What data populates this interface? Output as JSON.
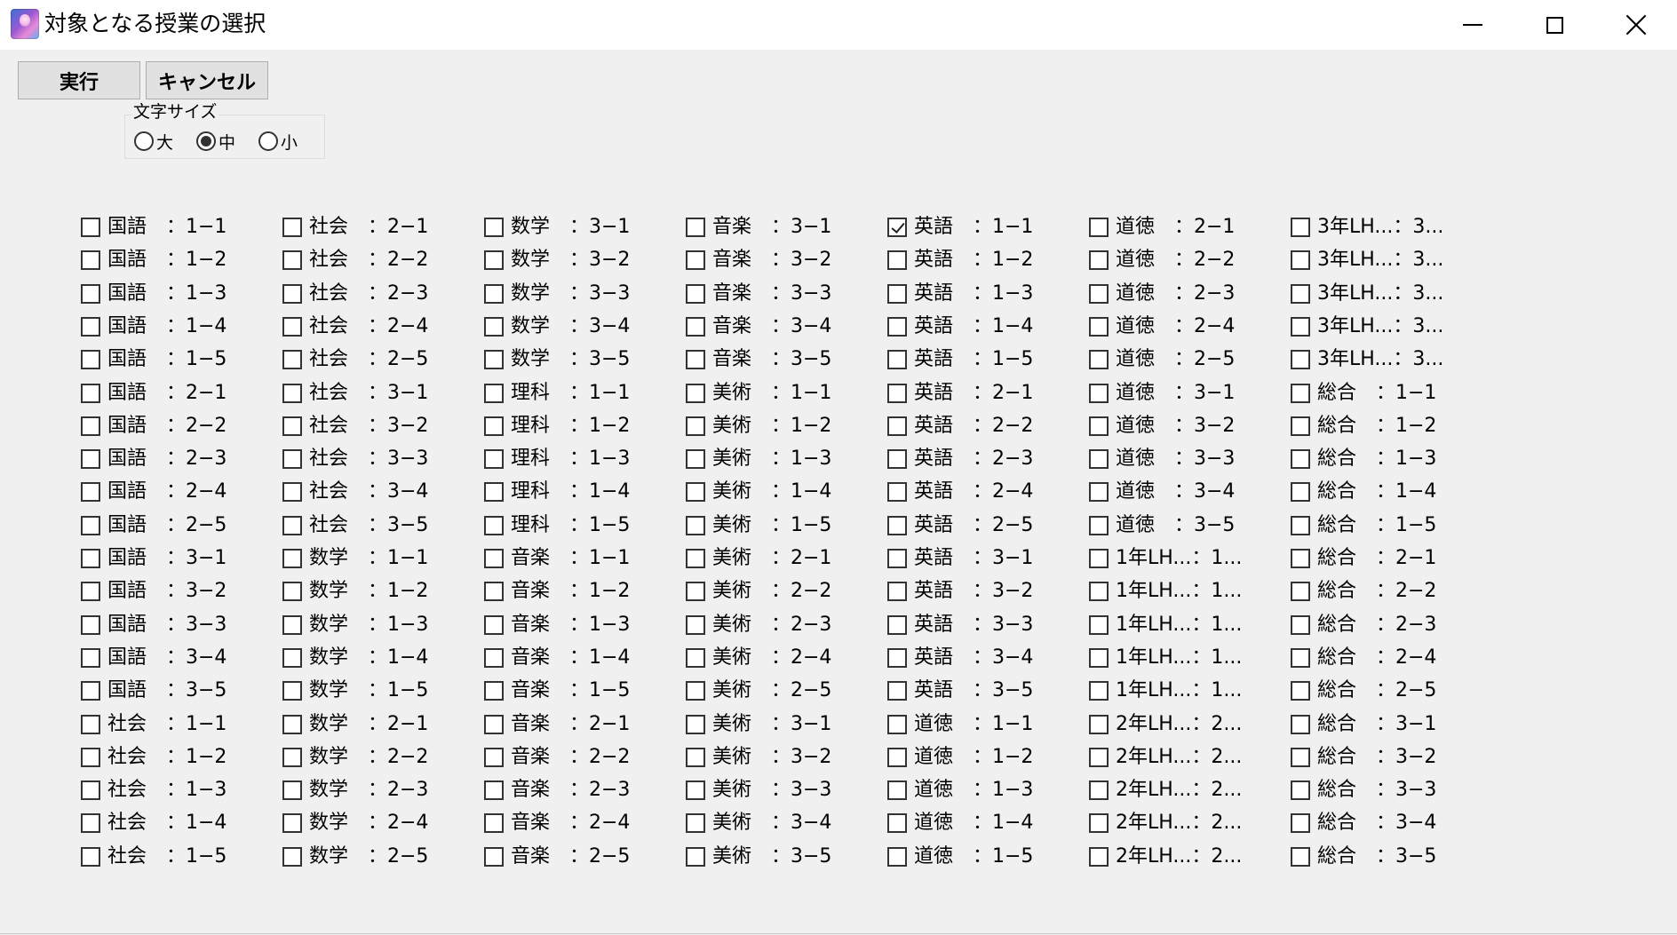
{
  "window": {
    "title": "対象となる授業の選択"
  },
  "toolbar": {
    "run_label": "実行",
    "cancel_label": "キャンセル"
  },
  "font_size": {
    "legend": "文字サイズ",
    "options": [
      {
        "label": "大",
        "selected": false
      },
      {
        "label": "中",
        "selected": true
      },
      {
        "label": "小",
        "selected": false
      }
    ]
  },
  "classes": {
    "columns": [
      [
        "国語　：1−1",
        "国語　：1−2",
        "国語　：1−3",
        "国語　：1−4",
        "国語　：1−5",
        "国語　：2−1",
        "国語　：2−2",
        "国語　：2−3",
        "国語　：2−4",
        "国語　：2−5",
        "国語　：3−1",
        "国語　：3−2",
        "国語　：3−3",
        "国語　：3−4",
        "国語　：3−5",
        "社会　：1−1",
        "社会　：1−2",
        "社会　：1−3",
        "社会　：1−4",
        "社会　：1−5"
      ],
      [
        "社会　：2−1",
        "社会　：2−2",
        "社会　：2−3",
        "社会　：2−4",
        "社会　：2−5",
        "社会　：3−1",
        "社会　：3−2",
        "社会　：3−3",
        "社会　：3−4",
        "社会　：3−5",
        "数学　：1−1",
        "数学　：1−2",
        "数学　：1−3",
        "数学　：1−4",
        "数学　：1−5",
        "数学　：2−1",
        "数学　：2−2",
        "数学　：2−3",
        "数学　：2−4",
        "数学　：2−5"
      ],
      [
        "数学　：3−1",
        "数学　：3−2",
        "数学　：3−3",
        "数学　：3−4",
        "数学　：3−5",
        "理科　：1−1",
        "理科　：1−2",
        "理科　：1−3",
        "理科　：1−4",
        "理科　：1−5",
        "音楽　：1−1",
        "音楽　：1−2",
        "音楽　：1−3",
        "音楽　：1−4",
        "音楽　：1−5",
        "音楽　：2−1",
        "音楽　：2−2",
        "音楽　：2−3",
        "音楽　：2−4",
        "音楽　：2−5"
      ],
      [
        "音楽　：3−1",
        "音楽　：3−2",
        "音楽　：3−3",
        "音楽　：3−4",
        "音楽　：3−5",
        "美術　：1−1",
        "美術　：1−2",
        "美術　：1−3",
        "美術　：1−4",
        "美術　：1−5",
        "美術　：2−1",
        "美術　：2−2",
        "美術　：2−3",
        "美術　：2−4",
        "美術　：2−5",
        "美術　：3−1",
        "美術　：3−2",
        "美術　：3−3",
        "美術　：3−4",
        "美術　：3−5"
      ],
      [
        "英語　：1−1",
        "英語　：1−2",
        "英語　：1−3",
        "英語　：1−4",
        "英語　：1−5",
        "英語　：2−1",
        "英語　：2−2",
        "英語　：2−3",
        "英語　：2−4",
        "英語　：2−5",
        "英語　：3−1",
        "英語　：3−2",
        "英語　：3−3",
        "英語　：3−4",
        "英語　：3−5",
        "道徳　：1−1",
        "道徳　：1−2",
        "道徳　：1−3",
        "道徳　：1−4",
        "道徳　：1−5"
      ],
      [
        "道徳　：2−1",
        "道徳　：2−2",
        "道徳　：2−3",
        "道徳　：2−4",
        "道徳　：2−5",
        "道徳　：3−1",
        "道徳　：3−2",
        "道徳　：3−3",
        "道徳　：3−4",
        "道徳　：3−5",
        "1年LH...：1...",
        "1年LH...：1...",
        "1年LH...：1...",
        "1年LH...：1...",
        "1年LH...：1...",
        "2年LH...：2...",
        "2年LH...：2...",
        "2年LH...：2...",
        "2年LH...：2...",
        "2年LH...：2..."
      ],
      [
        "3年LH...：3...",
        "3年LH...：3...",
        "3年LH...：3...",
        "3年LH...：3...",
        "3年LH...：3...",
        "総合　：1−1",
        "総合　：1−2",
        "総合　：1−3",
        "総合　：1−4",
        "総合　：1−5",
        "総合　：2−1",
        "総合　：2−2",
        "総合　：2−3",
        "総合　：2−4",
        "総合　：2−5",
        "総合　：3−1",
        "総合　：3−2",
        "総合　：3−3",
        "総合　：3−4",
        "総合　：3−5"
      ]
    ],
    "checked": [
      "英語　：1−1"
    ]
  }
}
